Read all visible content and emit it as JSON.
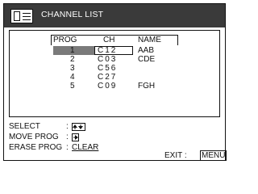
{
  "window": {
    "title": "CHANNEL LIST"
  },
  "table": {
    "headers": {
      "prog": "PROG",
      "ch": "CH",
      "name": "NAME"
    },
    "rows": [
      {
        "prog": "1",
        "ch": "C12",
        "name": "AAB",
        "selected": true
      },
      {
        "prog": "2",
        "ch": "C03",
        "name": "CDE",
        "selected": false
      },
      {
        "prog": "3",
        "ch": "C56",
        "name": "",
        "selected": false
      },
      {
        "prog": "4",
        "ch": "C27",
        "name": "",
        "selected": false
      },
      {
        "prog": "5",
        "ch": "C09",
        "name": "FGH",
        "selected": false
      }
    ]
  },
  "controls": {
    "select_label": "SELECT",
    "select_keys": [
      "up-arrow-icon",
      "down-arrow-icon"
    ],
    "move_label": "MOVE PROG",
    "move_key": "right-arrow-icon",
    "erase_label": "ERASE PROG",
    "clear_label": "CLEAR",
    "colon": ":",
    "exit_label": "EXIT  :",
    "menu_label": "MENU"
  },
  "colors": {
    "title_bar": "#3a3a3a",
    "highlight": "#7a7a7a"
  }
}
